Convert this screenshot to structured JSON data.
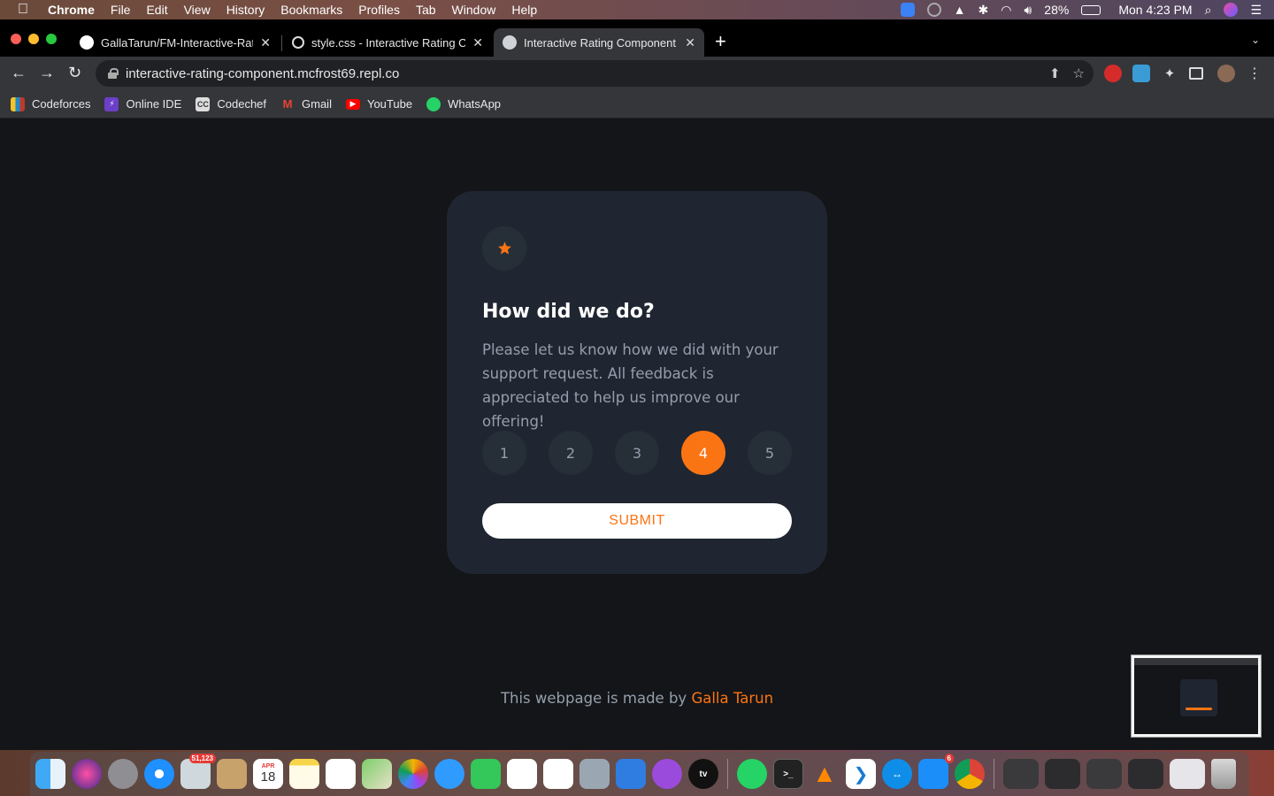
{
  "menubar": {
    "app_name": "Chrome",
    "menus": [
      "File",
      "Edit",
      "View",
      "History",
      "Bookmarks",
      "Profiles",
      "Tab",
      "Window",
      "Help"
    ],
    "battery": "28%",
    "clock": "Mon 4:23 PM"
  },
  "tabs": [
    {
      "title": "GallaTarun/FM-Interactive-Rati",
      "active": false
    },
    {
      "title": "style.css - Interactive Rating C",
      "active": false
    },
    {
      "title": "Interactive Rating Component",
      "active": true
    }
  ],
  "toolbar": {
    "url": "interactive-rating-component.mcfrost69.repl.co"
  },
  "bookmarks": [
    {
      "label": "Codeforces",
      "icon": "codeforces-icon"
    },
    {
      "label": "Online IDE",
      "icon": "online-ide-icon"
    },
    {
      "label": "Codechef",
      "icon": "codechef-icon"
    },
    {
      "label": "Gmail",
      "icon": "gmail-icon"
    },
    {
      "label": "YouTube",
      "icon": "youtube-icon"
    },
    {
      "label": "WhatsApp",
      "icon": "whatsapp-icon"
    }
  ],
  "card": {
    "title": "How did we do?",
    "description": "Please let us know how we did with your support request. All feedback is appreciated to help us improve our offering!",
    "ratings": [
      "1",
      "2",
      "3",
      "4",
      "5"
    ],
    "selected_rating": "4",
    "submit_label": "SUBMIT"
  },
  "footer": {
    "prefix": "This webpage is made by",
    "author": "Galla Tarun"
  },
  "dock": {
    "mail_badge": "51,123",
    "calendar_month": "APR",
    "calendar_day": "18",
    "appstore_badge": "6"
  },
  "colors": {
    "accent": "#fb7413",
    "card_bg": "#1f2631",
    "page_bg": "#131518",
    "muted_text": "#959eac"
  }
}
